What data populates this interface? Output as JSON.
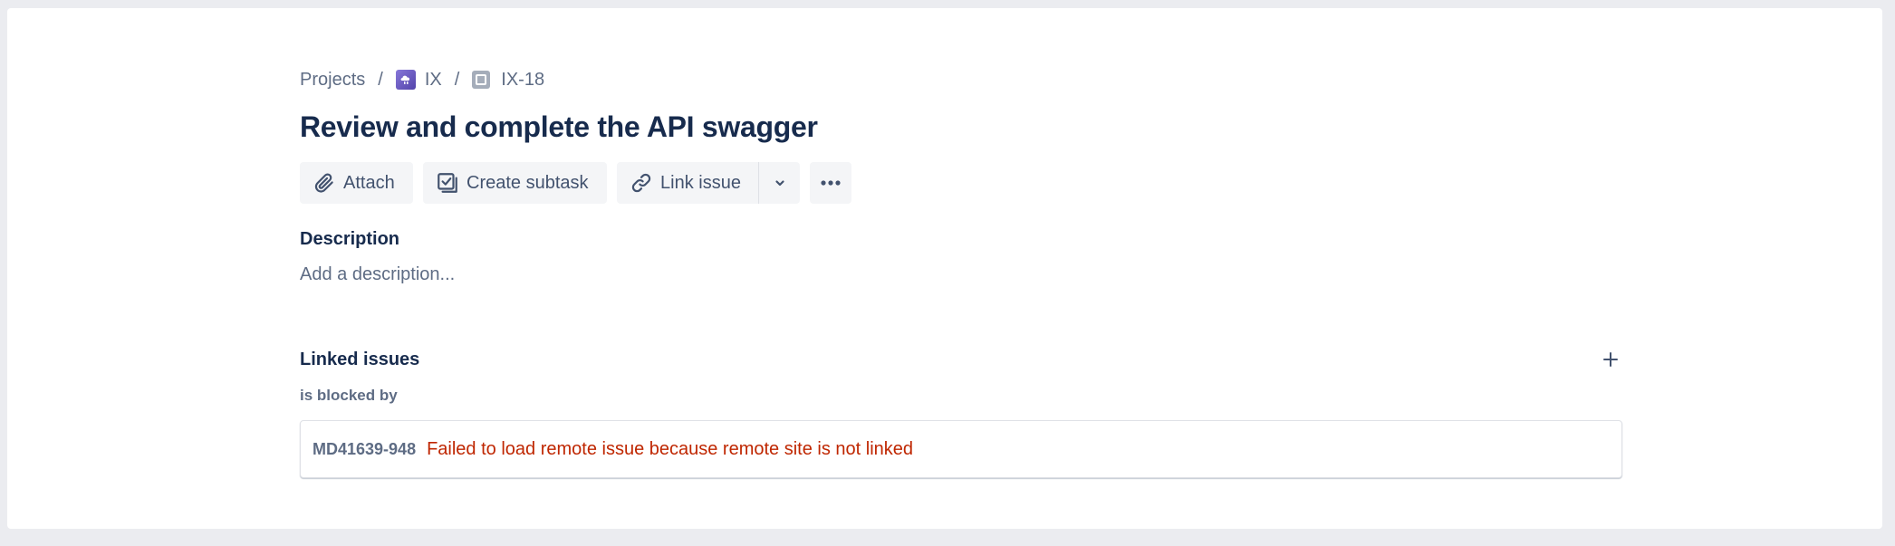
{
  "breadcrumb": {
    "projects": "Projects",
    "separator": "/",
    "project_key": "IX",
    "project_icon": "project-avatar-icon",
    "issue_key": "IX-18",
    "issue_type_icon": "task-icon"
  },
  "issue": {
    "title": "Review and complete the API swagger"
  },
  "toolbar": {
    "attach_label": "Attach",
    "attach_icon": "paperclip-icon",
    "subtask_label": "Create subtask",
    "subtask_icon": "subtask-icon",
    "link_label": "Link issue",
    "link_icon": "link-icon",
    "dropdown_icon": "chevron-down-icon",
    "more_icon": "more-icon"
  },
  "description": {
    "label": "Description",
    "placeholder": "Add a description..."
  },
  "linked_issues": {
    "label": "Linked issues",
    "add_icon": "plus-icon",
    "groups": [
      {
        "relation": "is blocked by",
        "items": [
          {
            "key": "MD41639-948",
            "message": "Failed to load remote issue because remote site is not linked"
          }
        ]
      }
    ]
  },
  "colors": {
    "text_primary": "#172b4d",
    "text_subtle": "#5e6c84",
    "button_bg": "#f4f5f7",
    "error": "#bf2600",
    "project_avatar": "#6554c0"
  }
}
